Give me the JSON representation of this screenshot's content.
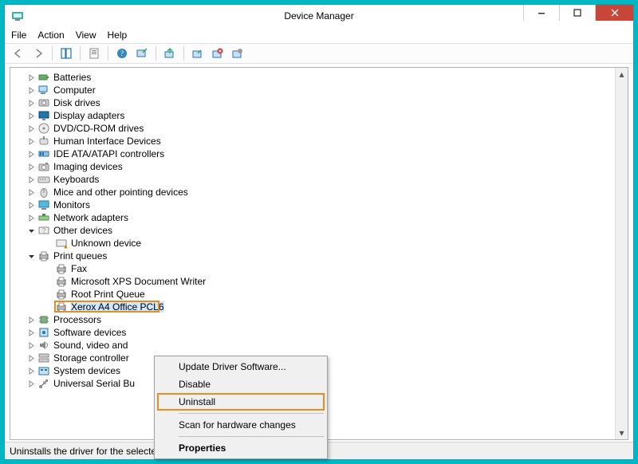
{
  "window_title": "Device Manager",
  "menus": {
    "file": "File",
    "action": "Action",
    "view": "View",
    "help": "Help"
  },
  "tree": {
    "items": [
      {
        "label": "Batteries",
        "icon": "battery"
      },
      {
        "label": "Computer",
        "icon": "computer"
      },
      {
        "label": "Disk drives",
        "icon": "disk"
      },
      {
        "label": "Display adapters",
        "icon": "display"
      },
      {
        "label": "DVD/CD-ROM drives",
        "icon": "cdrom"
      },
      {
        "label": "Human Interface Devices",
        "icon": "hid"
      },
      {
        "label": "IDE ATA/ATAPI controllers",
        "icon": "ide"
      },
      {
        "label": "Imaging devices",
        "icon": "camera"
      },
      {
        "label": "Keyboards",
        "icon": "keyboard"
      },
      {
        "label": "Mice and other pointing devices",
        "icon": "mouse"
      },
      {
        "label": "Monitors",
        "icon": "monitor"
      },
      {
        "label": "Network adapters",
        "icon": "network"
      },
      {
        "label": "Other devices",
        "icon": "other",
        "expanded": true,
        "children": [
          {
            "label": "Unknown device",
            "icon": "unknown-warn"
          }
        ]
      },
      {
        "label": "Print queues",
        "icon": "printer",
        "expanded": true,
        "children": [
          {
            "label": "Fax",
            "icon": "printer"
          },
          {
            "label": "Microsoft XPS Document Writer",
            "icon": "printer"
          },
          {
            "label": "Root Print Queue",
            "icon": "printer"
          },
          {
            "label": "Xerox A4 Office PCL6",
            "icon": "printer",
            "selected": true,
            "highlighted": true
          }
        ]
      },
      {
        "label": "Processors",
        "icon": "cpu"
      },
      {
        "label": "Software devices",
        "icon": "software"
      },
      {
        "label": "Sound, video and",
        "icon": "sound",
        "truncated": true
      },
      {
        "label": "Storage controller",
        "icon": "storage",
        "truncated": true
      },
      {
        "label": "System devices",
        "icon": "system"
      },
      {
        "label": "Universal Serial Bu",
        "icon": "usb",
        "truncated": true
      }
    ]
  },
  "context_menu": {
    "items": [
      {
        "label": "Update Driver Software..."
      },
      {
        "label": "Disable"
      },
      {
        "label": "Uninstall",
        "highlighted": true
      },
      {
        "sep": true
      },
      {
        "label": "Scan for hardware changes"
      },
      {
        "sep": true
      },
      {
        "label": "Properties",
        "bold": true
      }
    ]
  },
  "status_text": "Uninstalls the driver for the selected device."
}
